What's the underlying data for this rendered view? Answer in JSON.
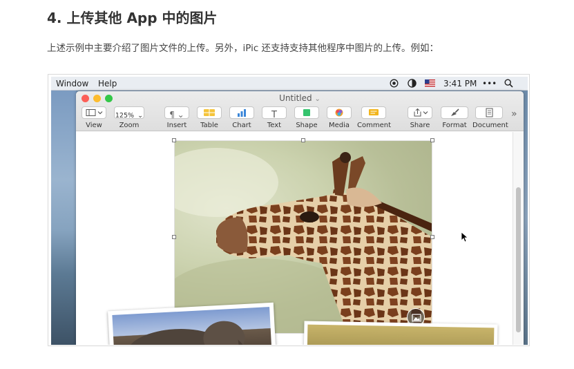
{
  "article": {
    "heading": "4. 上传其他 App 中的图片",
    "paragraph": "上述示例中主要介绍了图片文件的上传。另外，iPic 还支持支持其他程序中图片的上传。例如："
  },
  "menubar": {
    "items": [
      "Window",
      "Help"
    ],
    "time": "3:41 PM",
    "more": "•••",
    "icons": [
      "record-icon",
      "contrast-icon",
      "us-flag-icon",
      "search-icon"
    ]
  },
  "window": {
    "title": "Untitled",
    "title_chevron": "⌄",
    "toolbar": [
      {
        "label": "View",
        "icon": "view-icon"
      },
      {
        "label": "Zoom",
        "value": "125%"
      },
      {
        "label": "Insert",
        "icon": "paragraph-icon"
      },
      {
        "label": "Table",
        "icon": "table-icon"
      },
      {
        "label": "Chart",
        "icon": "chart-icon"
      },
      {
        "label": "Text",
        "icon": "text-icon"
      },
      {
        "label": "Shape",
        "icon": "shape-icon"
      },
      {
        "label": "Media",
        "icon": "media-icon"
      },
      {
        "label": "Comment",
        "icon": "comment-icon"
      },
      {
        "label": "Share",
        "icon": "share-icon"
      },
      {
        "label": "Format",
        "icon": "format-icon"
      },
      {
        "label": "Document",
        "icon": "document-icon"
      }
    ],
    "overflow": "»"
  },
  "colors": {
    "close": "#fc5f57",
    "minimize": "#fdbc2e",
    "zoom": "#33c748",
    "table_yellow": "#f5c43b",
    "chart_blue": "#3a86d8",
    "shape_green": "#35c46e",
    "comment_yellow": "#f2b51c"
  }
}
